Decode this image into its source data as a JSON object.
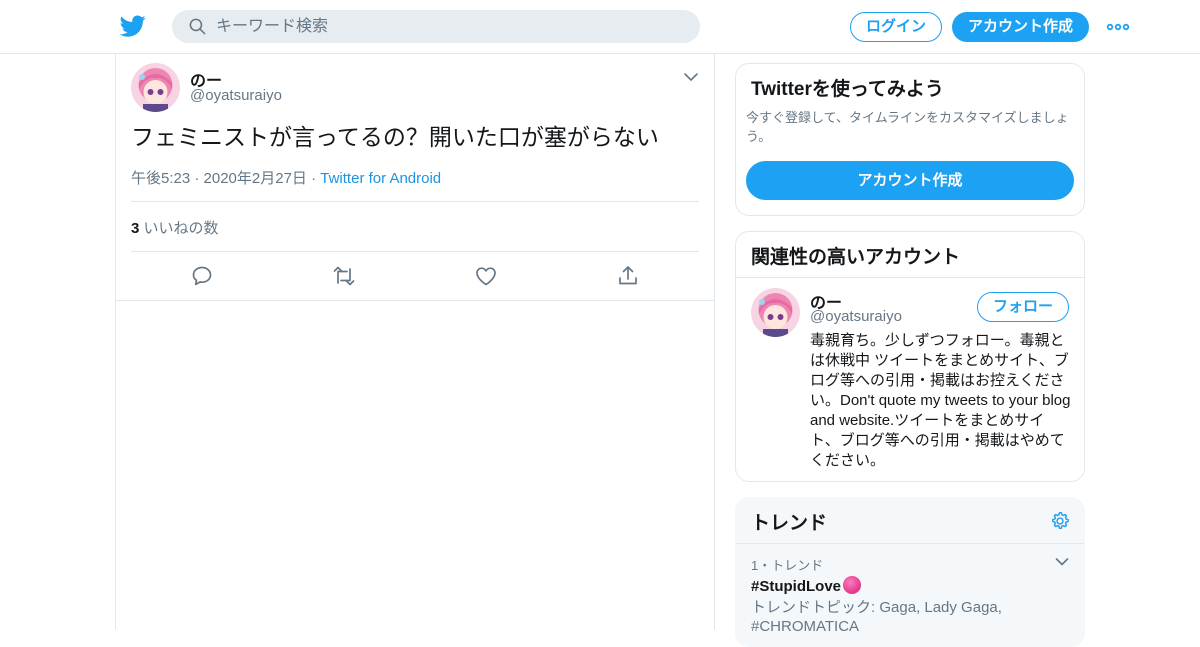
{
  "header": {
    "search_placeholder": "キーワード検索",
    "login_label": "ログイン",
    "signup_label": "アカウント作成",
    "logo_icon": "twitter-bird-icon",
    "more_icon": "more-dots-icon"
  },
  "tweet": {
    "user_name": "のー",
    "user_handle": "@oyatsuraiyo",
    "text": "フェミニストが言ってるの？開いた口が塞がらない",
    "time": "午後5:23 · 2020年2月27日 · ",
    "client": "Twitter for Android",
    "like_count": "3",
    "like_label": " いいねの数",
    "actions": [
      "reply-icon",
      "retweet-icon",
      "like-icon",
      "share-icon"
    ]
  },
  "signup_card": {
    "title": "Twitterを使ってみよう",
    "description": "今すぐ登録して、タイムラインをカスタマイズしましょう。",
    "button_label": "アカウント作成"
  },
  "related_card": {
    "title": "関連性の高いアカウント",
    "user_name": "のー",
    "user_handle": "@oyatsuraiyo",
    "follow_label": "フォロー",
    "bio": "毒親育ち。少しずつフォロー。毒親とは休戦中 ツイートをまとめサイト、ブログ等への引用・掲載はお控えください。Don't quote my tweets to your blog and website.ツイートをまとめサイト、ブログ等への引用・掲載はやめてください。"
  },
  "trends_card": {
    "title": "トレンド",
    "items": [
      {
        "rank": "1・トレンド",
        "tag": "#StupidLove",
        "topics": "トレンドトピック: Gaga, Lady Gaga, #CHROMATICA"
      }
    ]
  },
  "colors": {
    "brand_blue": "#1da1f2",
    "link_blue": "#1b95e0",
    "muted_text": "#657786",
    "border": "#e1e8ed"
  }
}
